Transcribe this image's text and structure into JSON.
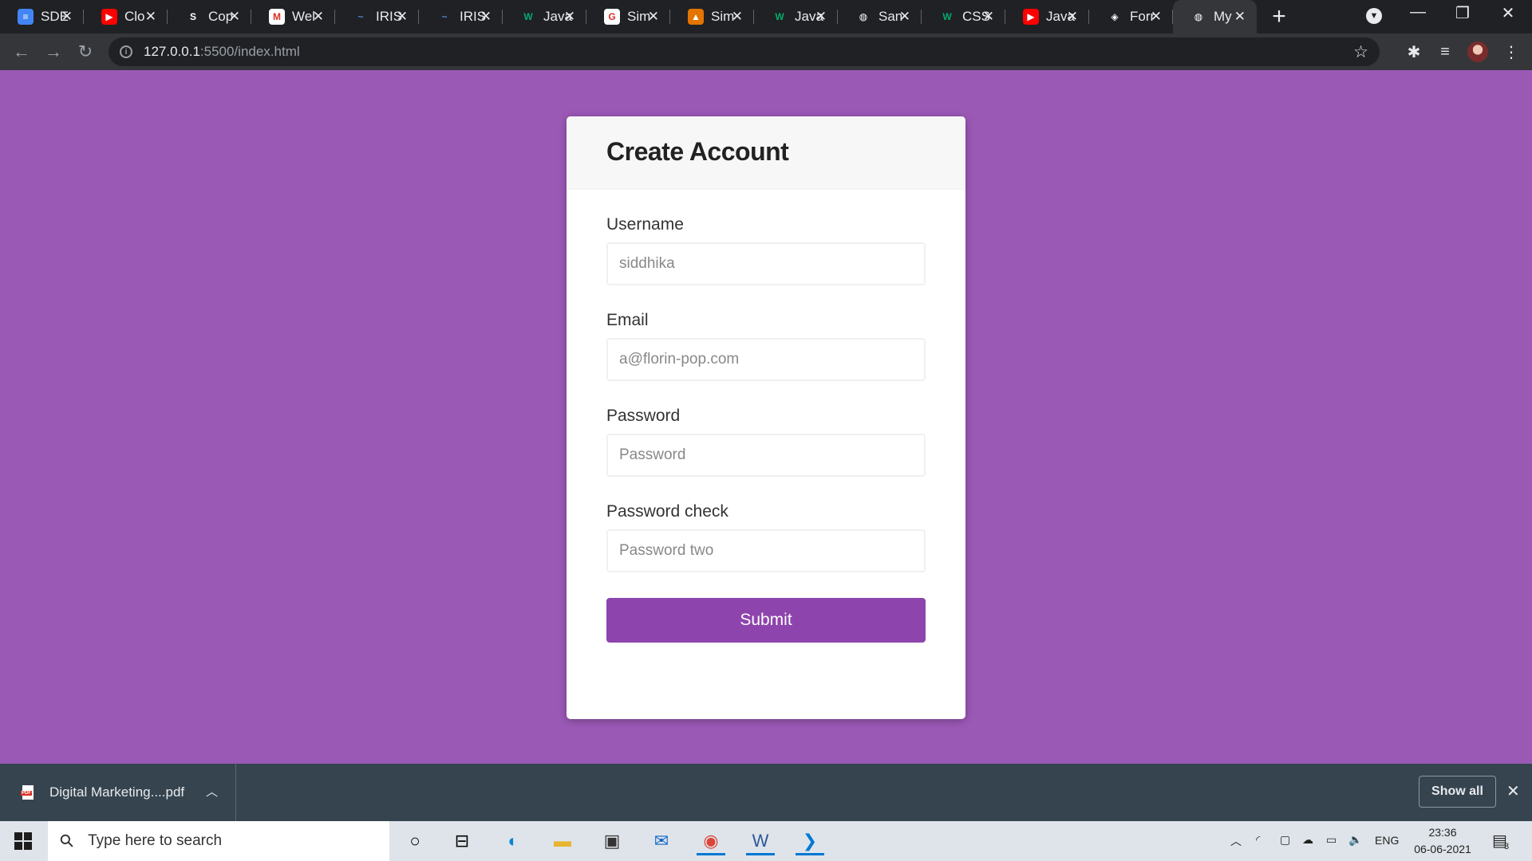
{
  "browser": {
    "tabs": [
      {
        "title": "SDE",
        "icon": "docs-icon",
        "color": "#4285f4",
        "glyph": "≡",
        "active": false
      },
      {
        "title": "Clo",
        "icon": "youtube-icon",
        "color": "#ff0000",
        "glyph": "▶",
        "active": false
      },
      {
        "title": "Cop",
        "icon": "brand-icon",
        "color": "#202124",
        "glyph": "S",
        "active": false
      },
      {
        "title": "Wel",
        "icon": "gmail-icon",
        "color": "#ffffff",
        "glyph": "M",
        "active": false
      },
      {
        "title": "IRIS",
        "icon": "iris-icon",
        "color": "#202124",
        "glyph": "~",
        "active": false
      },
      {
        "title": "IRIS",
        "icon": "iris-icon",
        "color": "#202124",
        "glyph": "~",
        "active": false
      },
      {
        "title": "Java",
        "icon": "w3schools-icon",
        "color": "#202124",
        "glyph": "W",
        "active": false
      },
      {
        "title": "Sim",
        "icon": "google-icon",
        "color": "#ffffff",
        "glyph": "G",
        "active": false
      },
      {
        "title": "Sim",
        "icon": "person-icon",
        "color": "#e37400",
        "glyph": "▲",
        "active": false
      },
      {
        "title": "Java",
        "icon": "w3schools-icon",
        "color": "#202124",
        "glyph": "W",
        "active": false
      },
      {
        "title": "San",
        "icon": "globe-icon",
        "color": "#202124",
        "glyph": "◍",
        "active": false
      },
      {
        "title": "CSS",
        "icon": "w3schools-icon",
        "color": "#202124",
        "glyph": "W",
        "active": false
      },
      {
        "title": "Java",
        "icon": "youtube-icon",
        "color": "#ff0000",
        "glyph": "▶",
        "active": false
      },
      {
        "title": "Forr",
        "icon": "codepen-icon",
        "color": "#202124",
        "glyph": "◈",
        "active": false
      },
      {
        "title": "My",
        "icon": "globe-icon",
        "color": "#35363a",
        "glyph": "◍",
        "active": true
      }
    ],
    "url_host": "127.0.0.1",
    "url_rest": ":5500/index.html"
  },
  "form": {
    "title": "Create Account",
    "fields": [
      {
        "label": "Username",
        "placeholder": "siddhika",
        "type": "text"
      },
      {
        "label": "Email",
        "placeholder": "a@florin-pop.com",
        "type": "text"
      },
      {
        "label": "Password",
        "placeholder": "Password",
        "type": "password"
      },
      {
        "label": "Password check",
        "placeholder": "Password two",
        "type": "password"
      }
    ],
    "submit_label": "Submit"
  },
  "downloads": {
    "file_name": "Digital Marketing....pdf",
    "show_all_label": "Show all"
  },
  "taskbar": {
    "search_placeholder": "Type here to search",
    "language": "ENG",
    "time": "23:36",
    "date": "06-06-2021",
    "notification_count": "3"
  },
  "colors": {
    "page_background": "#9b59b6",
    "submit_button": "#8e44ad"
  }
}
